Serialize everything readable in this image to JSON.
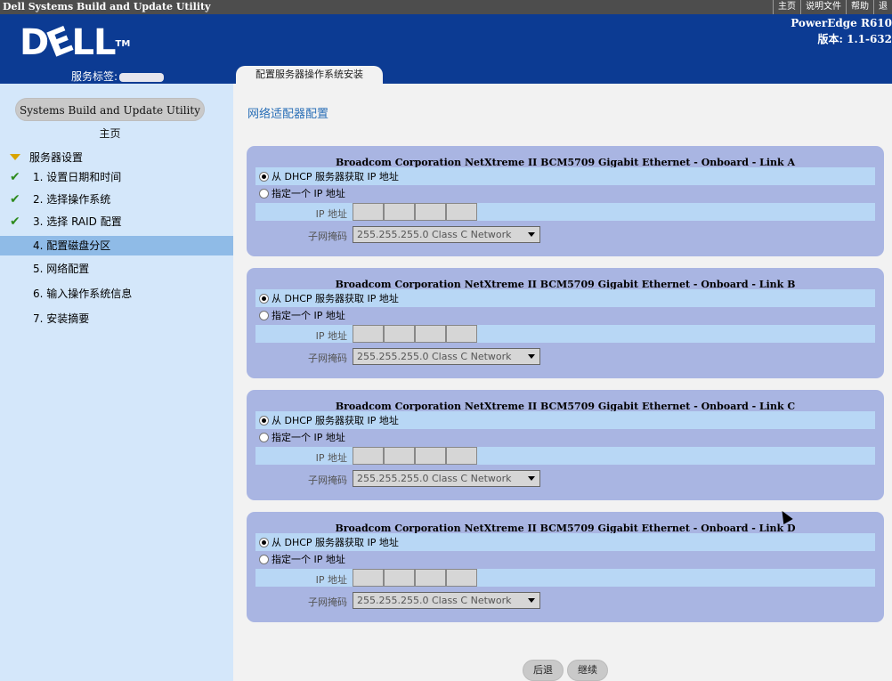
{
  "app": {
    "title": "Dell Systems Build and Update Utility",
    "menu": [
      "主页",
      "说明文件",
      "帮助",
      "退"
    ]
  },
  "header": {
    "logo": {
      "d": "D",
      "e": "E",
      "ll": "LL",
      "tm": "TM"
    },
    "service_tag_label": "服务标签:",
    "model": "PowerEdge R610",
    "version": "版本: 1.1-632",
    "tab": "配置服务器操作系统安装"
  },
  "sidebar": {
    "home_button": "Systems Build and Update Utility 主页",
    "section": "服务器设置",
    "steps": [
      {
        "label": "1. 设置日期和时间",
        "done": true
      },
      {
        "label": "2. 选择操作系统",
        "done": true
      },
      {
        "label": "3. 选择 RAID 配置",
        "done": true
      },
      {
        "label": "4. 配置磁盘分区",
        "active": true
      },
      {
        "label": "5. 网络配置"
      },
      {
        "label": "6. 输入操作系统信息"
      },
      {
        "label": "7. 安装摘要"
      }
    ]
  },
  "main": {
    "page_title": "网络适配器配置",
    "nics": [
      {
        "name": "Broadcom Corporation NetXtreme II BCM5709 Gigabit Ethernet - Onboard - Link A"
      },
      {
        "name": "Broadcom Corporation NetXtreme II BCM5709 Gigabit Ethernet - Onboard - Link B"
      },
      {
        "name": "Broadcom Corporation NetXtreme II BCM5709 Gigabit Ethernet - Onboard - Link C"
      },
      {
        "name": "Broadcom Corporation NetXtreme II BCM5709 Gigabit Ethernet - Onboard - Link D"
      }
    ],
    "dhcp_label": "从 DHCP 服务器获取 IP 地址",
    "static_label": "指定一个 IP 地址",
    "ip_label": "IP 地址",
    "subnet_label": "子网掩码",
    "subnet_value": "255.255.255.0 Class C Network",
    "back_button": "后退",
    "next_button": "继续"
  }
}
